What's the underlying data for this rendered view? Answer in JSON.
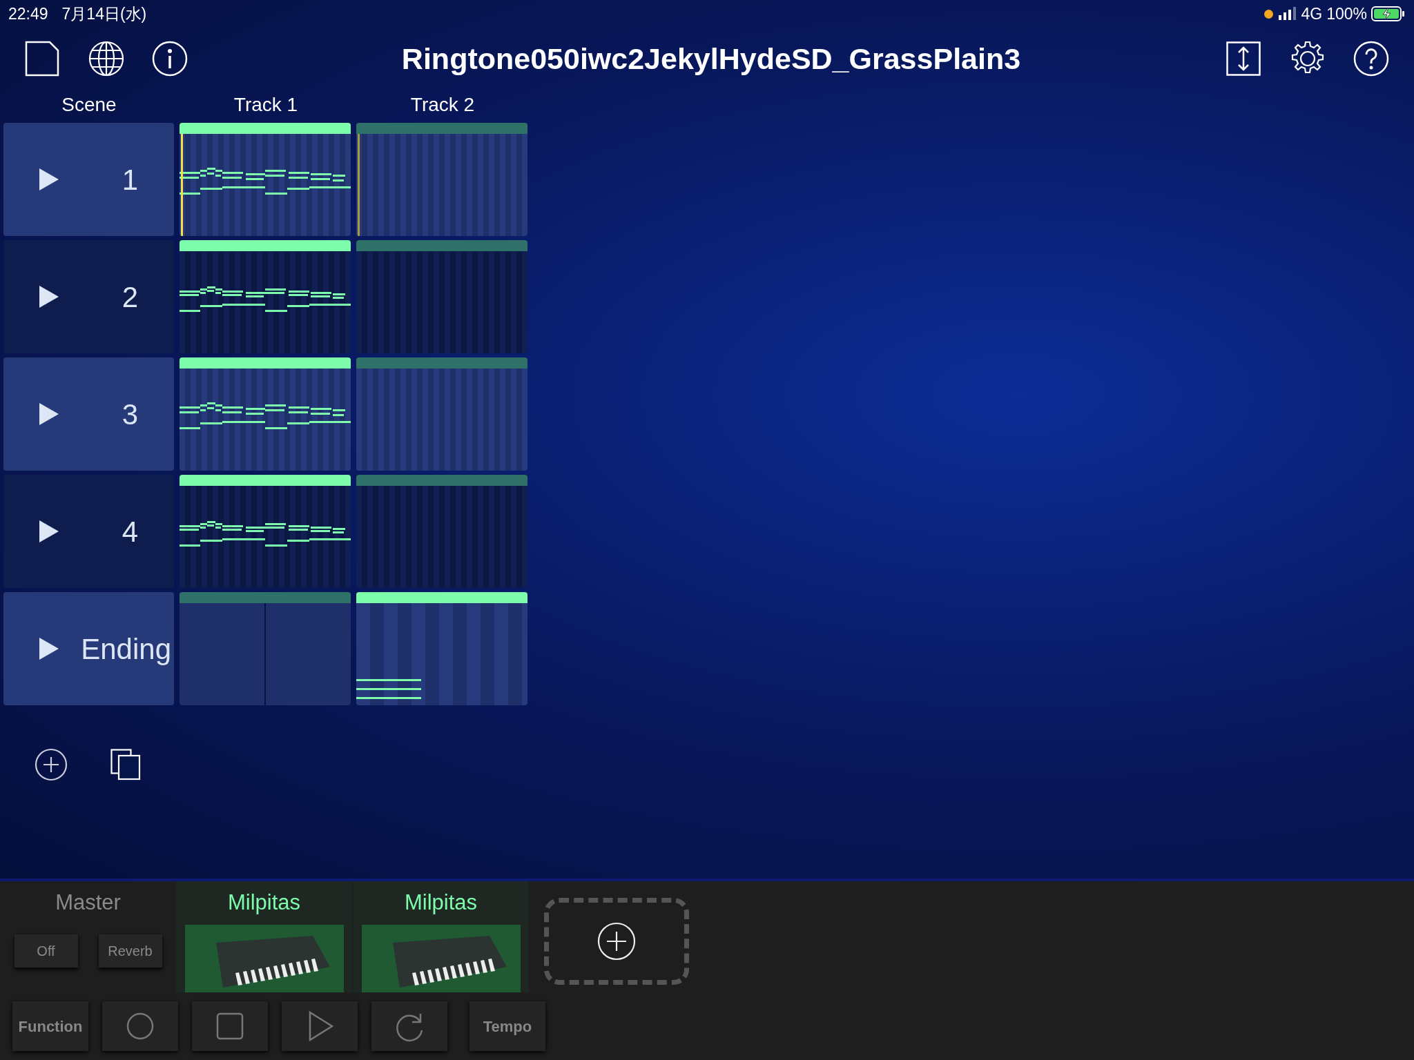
{
  "status_bar": {
    "time": "22:49",
    "date": "7月14日(水)",
    "network": "4G",
    "battery": "100%",
    "charging": true
  },
  "title": "Ringtone050iwc2JekylHydeSD_GrassPlain3",
  "columns": [
    "Scene",
    "Track 1",
    "Track 2"
  ],
  "scenes": [
    {
      "label": "1",
      "selected": true,
      "playing": true,
      "clips": [
        {
          "active": true,
          "kind": "melody"
        },
        {
          "active": false,
          "kind": "empty"
        }
      ]
    },
    {
      "label": "2",
      "selected": false,
      "playing": false,
      "clips": [
        {
          "active": true,
          "kind": "melody"
        },
        {
          "active": false,
          "kind": "empty"
        }
      ]
    },
    {
      "label": "3",
      "selected": true,
      "playing": false,
      "clips": [
        {
          "active": true,
          "kind": "melody"
        },
        {
          "active": false,
          "kind": "empty"
        }
      ]
    },
    {
      "label": "4",
      "selected": false,
      "playing": false,
      "clips": [
        {
          "active": true,
          "kind": "melody"
        },
        {
          "active": false,
          "kind": "empty"
        }
      ]
    },
    {
      "label": "Ending",
      "selected": true,
      "playing": false,
      "clips": [
        {
          "active": false,
          "kind": "blank"
        },
        {
          "active": true,
          "kind": "chord"
        }
      ]
    }
  ],
  "master": {
    "label": "Master",
    "buttons": [
      "Off",
      "Reverb"
    ]
  },
  "instruments": [
    {
      "name": "Milpitas"
    },
    {
      "name": "Milpitas"
    }
  ],
  "transport": [
    {
      "kind": "text",
      "label": "Function"
    },
    {
      "kind": "record"
    },
    {
      "kind": "stop"
    },
    {
      "kind": "play"
    },
    {
      "kind": "loop"
    },
    {
      "kind": "text",
      "label": "Tempo"
    }
  ]
}
